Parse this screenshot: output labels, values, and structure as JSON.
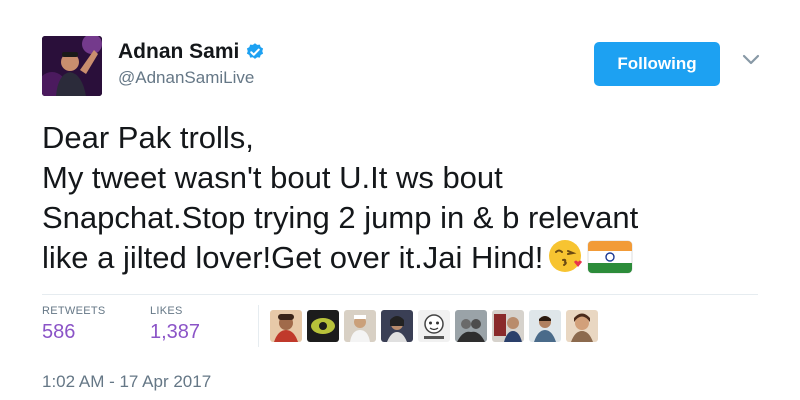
{
  "author": {
    "display_name": "Adnan Sami",
    "handle": "@AdnanSamiLive",
    "verified_icon": "verified-badge-icon"
  },
  "follow_button": {
    "label": "Following"
  },
  "tweet": {
    "lines": [
      "Dear Pak trolls,",
      "My tweet wasn't bout U.It ws bout",
      "Snapchat.Stop trying 2 jump in & b relevant",
      "like a jilted lover!Get over it.Jai Hind!"
    ],
    "emojis": [
      "face-blowing-a-kiss",
      "flag-india"
    ]
  },
  "stats": {
    "retweets_label": "RETWEETS",
    "retweets_value": "586",
    "likes_label": "LIKES",
    "likes_value": "1,387"
  },
  "liked_by_avatar_count": 9,
  "timestamp": "1:02 AM - 17 Apr 2017",
  "colors": {
    "accent": "#1da1f2",
    "stat_value": "#8b54c7",
    "muted": "#657786"
  }
}
